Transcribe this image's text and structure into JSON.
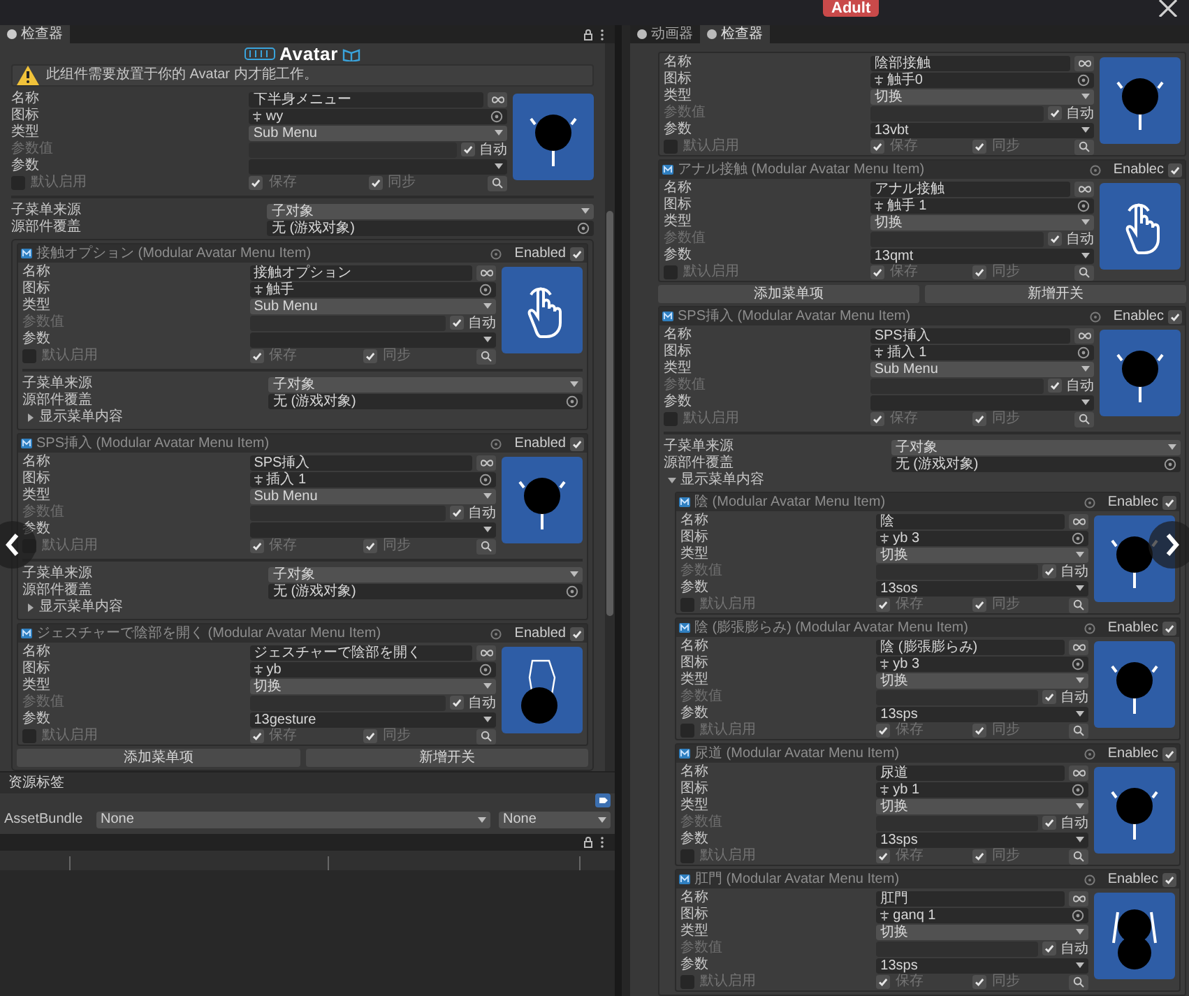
{
  "top_strip": {
    "badge": "Adult"
  },
  "left": {
    "tab": "检查器",
    "logo": "Avatar",
    "warning": "此组件需要放置于你的 Avatar 内才能工作。",
    "main": {
      "preview": {
        "kind": "blot"
      },
      "rows": [
        {
          "kind": "text",
          "label": "名称",
          "value": "下半身メニュー"
        },
        {
          "kind": "object",
          "label": "图标",
          "value": "wy"
        },
        {
          "kind": "dropdown",
          "label": "类型",
          "value": "Sub Menu"
        },
        {
          "kind": "auto",
          "label": "参数值",
          "check_label": "自动",
          "checked": true
        },
        {
          "kind": "param",
          "label": "参数"
        }
      ],
      "toggles": [
        {
          "label": "默认启用",
          "checked": false
        },
        {
          "label": "保存",
          "checked": true
        },
        {
          "label": "同步",
          "checked": true
        }
      ],
      "submenu": {
        "source_label": "子菜单来源",
        "source": "子对象",
        "override_label": "源部件覆盖",
        "override": "无 (游戏对象)",
        "children": [
          {
            "kind": "item",
            "title": "接触オプション (Modular Avatar Menu Item)",
            "enabled_label": "Enabled",
            "enabled": true,
            "preview": {
              "kind": "hand"
            },
            "rows": [
              {
                "kind": "text",
                "label": "名称",
                "value": "接触オプション"
              },
              {
                "kind": "object",
                "label": "图标",
                "value": "触手"
              },
              {
                "kind": "dropdown",
                "label": "类型",
                "value": "Sub Menu"
              },
              {
                "kind": "auto",
                "label": "参数值",
                "check_label": "自动",
                "checked": true
              },
              {
                "kind": "param",
                "label": "参数"
              }
            ],
            "toggles": [
              {
                "label": "默认启用",
                "checked": false
              },
              {
                "label": "保存",
                "checked": true
              },
              {
                "label": "同步",
                "checked": true
              }
            ],
            "submenu": {
              "source_label": "子菜单来源",
              "source": "子对象",
              "override_label": "源部件覆盖",
              "override": "无 (游戏对象)",
              "foldout": {
                "label": "显示菜单内容",
                "expanded": false
              }
            }
          },
          {
            "kind": "item",
            "title": "SPS挿入 (Modular Avatar Menu Item)",
            "enabled_label": "Enabled",
            "enabled": true,
            "preview": {
              "kind": "blot"
            },
            "rows": [
              {
                "kind": "text",
                "label": "名称",
                "value": "SPS挿入"
              },
              {
                "kind": "object",
                "label": "图标",
                "value": "插入 1"
              },
              {
                "kind": "dropdown",
                "label": "类型",
                "value": "Sub Menu"
              },
              {
                "kind": "auto",
                "label": "参数值",
                "check_label": "自动",
                "checked": true
              },
              {
                "kind": "param",
                "label": "参数"
              }
            ],
            "toggles": [
              {
                "label": "默认启用",
                "checked": false
              },
              {
                "label": "保存",
                "checked": true
              },
              {
                "label": "同步",
                "checked": true
              }
            ],
            "submenu": {
              "source_label": "子菜单来源",
              "source": "子对象",
              "override_label": "源部件覆盖",
              "override": "无 (游戏对象)",
              "foldout": {
                "label": "显示菜单内容",
                "expanded": false
              }
            }
          },
          {
            "kind": "item",
            "title": "ジェスチャーで陰部を開く (Modular Avatar Menu Item)",
            "enabled_label": "Enabled",
            "enabled": true,
            "preview": {
              "kind": "gesture"
            },
            "rows": [
              {
                "kind": "text",
                "label": "名称",
                "value": "ジェスチャーで陰部を開く"
              },
              {
                "kind": "object",
                "label": "图标",
                "value": "yb"
              },
              {
                "kind": "dropdown",
                "label": "类型",
                "value": "切换"
              },
              {
                "kind": "auto",
                "label": "参数值",
                "check_label": "自动",
                "checked": true
              },
              {
                "kind": "param",
                "label": "参数",
                "value": "13gesture"
              }
            ],
            "toggles": [
              {
                "label": "默认启用",
                "checked": false
              },
              {
                "label": "保存",
                "checked": true
              },
              {
                "label": "同步",
                "checked": true
              }
            ]
          },
          {
            "kind": "buttons",
            "labels": [
              "添加菜单项",
              "新增开关"
            ]
          }
        ]
      }
    },
    "assets": {
      "title": "资源标签",
      "bundle_label": "AssetBundle",
      "bundle": "None",
      "variant": "None"
    }
  },
  "right": {
    "tabs": [
      {
        "label": "动画器",
        "selected": false
      },
      {
        "label": "检查器",
        "selected": true
      }
    ],
    "entries": [
      {
        "kind": "item",
        "preview": {
          "kind": "blot"
        },
        "rows": [
          {
            "kind": "text",
            "label": "名称",
            "value": "陰部接触"
          },
          {
            "kind": "object",
            "label": "图标",
            "value": "触手0"
          },
          {
            "kind": "dropdown",
            "label": "类型",
            "value": "切换"
          },
          {
            "kind": "auto",
            "label": "参数值",
            "check_label": "自动",
            "checked": true
          },
          {
            "kind": "param",
            "label": "参数",
            "value": "13vbt"
          }
        ],
        "toggles": [
          {
            "label": "默认启用",
            "checked": false
          },
          {
            "label": "保存",
            "checked": true
          },
          {
            "label": "同步",
            "checked": true
          }
        ]
      },
      {
        "kind": "item",
        "title": "アナル接触 (Modular Avatar Menu Item)",
        "enabled_label": "Enablec",
        "enabled": true,
        "preview": {
          "kind": "hand"
        },
        "rows": [
          {
            "kind": "text",
            "label": "名称",
            "value": "アナル接触"
          },
          {
            "kind": "object",
            "label": "图标",
            "value": "触手 1"
          },
          {
            "kind": "dropdown",
            "label": "类型",
            "value": "切换"
          },
          {
            "kind": "auto",
            "label": "参数值",
            "check_label": "自动",
            "checked": true
          },
          {
            "kind": "param",
            "label": "参数",
            "value": "13qmt"
          }
        ],
        "toggles": [
          {
            "label": "默认启用",
            "checked": false
          },
          {
            "label": "保存",
            "checked": true
          },
          {
            "label": "同步",
            "checked": true
          }
        ]
      },
      {
        "kind": "buttons",
        "labels": [
          "添加菜单项",
          "新增开关"
        ]
      },
      {
        "kind": "item",
        "title": "SPS挿入 (Modular Avatar Menu Item)",
        "enabled_label": "Enablec",
        "enabled": true,
        "preview": {
          "kind": "blot"
        },
        "rows": [
          {
            "kind": "text",
            "label": "名称",
            "value": "SPS挿入"
          },
          {
            "kind": "object",
            "label": "图标",
            "value": "插入 1"
          },
          {
            "kind": "dropdown",
            "label": "类型",
            "value": "Sub Menu"
          },
          {
            "kind": "auto",
            "label": "参数值",
            "check_label": "自动",
            "checked": true
          },
          {
            "kind": "param",
            "label": "参数"
          }
        ],
        "toggles": [
          {
            "label": "默认启用",
            "checked": false
          },
          {
            "label": "保存",
            "checked": true
          },
          {
            "label": "同步",
            "checked": true
          }
        ],
        "submenu": {
          "source_label": "子菜单来源",
          "source": "子对象",
          "override_label": "源部件覆盖",
          "override": "无 (游戏对象)",
          "foldout": {
            "label": "显示菜单内容",
            "expanded": true
          },
          "children": [
            {
              "kind": "item",
              "title": "陰 (Modular Avatar Menu Item)",
              "enabled_label": "Enablec",
              "enabled": true,
              "preview": {
                "kind": "blot"
              },
              "rows": [
                {
                  "kind": "text",
                  "label": "名称",
                  "value": "陰"
                },
                {
                  "kind": "object",
                  "label": "图标",
                  "value": "yb 3"
                },
                {
                  "kind": "dropdown",
                  "label": "类型",
                  "value": "切换"
                },
                {
                  "kind": "auto",
                  "label": "参数值",
                  "check_label": "自动",
                  "checked": true
                },
                {
                  "kind": "param",
                  "label": "参数",
                  "value": "13sos"
                }
              ],
              "toggles": [
                {
                  "label": "默认启用",
                  "checked": false
                },
                {
                  "label": "保存",
                  "checked": true
                },
                {
                  "label": "同步",
                  "checked": true
                }
              ]
            },
            {
              "kind": "item",
              "title": "陰 (膨張膨らみ) (Modular Avatar Menu Item)",
              "enabled_label": "Enablec",
              "enabled": true,
              "preview": {
                "kind": "blot"
              },
              "rows": [
                {
                  "kind": "text",
                  "label": "名称",
                  "value": "陰 (膨張膨らみ)"
                },
                {
                  "kind": "object",
                  "label": "图标",
                  "value": "yb 3"
                },
                {
                  "kind": "dropdown",
                  "label": "类型",
                  "value": "切换"
                },
                {
                  "kind": "auto",
                  "label": "参数值",
                  "check_label": "自动",
                  "checked": true
                },
                {
                  "kind": "param",
                  "label": "参数",
                  "value": "13sps"
                }
              ],
              "toggles": [
                {
                  "label": "默认启用",
                  "checked": false
                },
                {
                  "label": "保存",
                  "checked": true
                },
                {
                  "label": "同步",
                  "checked": true
                }
              ]
            },
            {
              "kind": "item",
              "title": "尿道 (Modular Avatar Menu Item)",
              "enabled_label": "Enablec",
              "enabled": true,
              "preview": {
                "kind": "blot"
              },
              "rows": [
                {
                  "kind": "text",
                  "label": "名称",
                  "value": "尿道"
                },
                {
                  "kind": "object",
                  "label": "图标",
                  "value": "yb 1"
                },
                {
                  "kind": "dropdown",
                  "label": "类型",
                  "value": "切换"
                },
                {
                  "kind": "auto",
                  "label": "参数值",
                  "check_label": "自动",
                  "checked": true
                },
                {
                  "kind": "param",
                  "label": "参数",
                  "value": "13sps"
                }
              ],
              "toggles": [
                {
                  "label": "默认启用",
                  "checked": false
                },
                {
                  "label": "保存",
                  "checked": true
                },
                {
                  "label": "同步",
                  "checked": true
                }
              ]
            },
            {
              "kind": "item",
              "title": "肛門 (Modular Avatar Menu Item)",
              "enabled_label": "Enablec",
              "enabled": true,
              "preview": {
                "kind": "double"
              },
              "rows": [
                {
                  "kind": "text",
                  "label": "名称",
                  "value": "肛門"
                },
                {
                  "kind": "object",
                  "label": "图标",
                  "value": "ganq 1"
                },
                {
                  "kind": "dropdown",
                  "label": "类型",
                  "value": "切换"
                },
                {
                  "kind": "auto",
                  "label": "参数值",
                  "check_label": "自动",
                  "checked": true
                },
                {
                  "kind": "param",
                  "label": "参数",
                  "value": "13sps"
                }
              ],
              "toggles": [
                {
                  "label": "默认启用",
                  "checked": false
                },
                {
                  "label": "保存",
                  "checked": true
                },
                {
                  "label": "同步",
                  "checked": true
                }
              ]
            }
          ]
        }
      }
    ]
  }
}
